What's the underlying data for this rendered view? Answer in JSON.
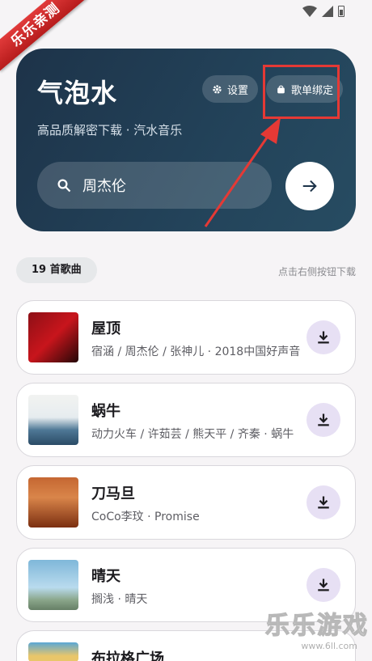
{
  "watermark": {
    "ribbon": "乐乐亲测",
    "brand": "乐乐游戏",
    "url": "www.6ll.com"
  },
  "header": {
    "title": "气泡水",
    "subtitle": "高品质解密下载 · 汽水音乐",
    "settings_label": "设置",
    "bind_label": "歌单绑定",
    "search_value": "周杰伦"
  },
  "summary": {
    "count_label": "19 首歌曲",
    "hint": "点击右侧按钮下载"
  },
  "songs": [
    {
      "title": "屋顶",
      "subtitle": "宿涵 / 周杰伦 / 张神儿 · 2018中国好声音"
    },
    {
      "title": "蜗牛",
      "subtitle": "动力火车 / 许茹芸 / 熊天平 / 齐秦 · 蜗牛"
    },
    {
      "title": "刀马旦",
      "subtitle": "CoCo李玟 · Promise"
    },
    {
      "title": "晴天",
      "subtitle": "搁浅 · 晴天"
    },
    {
      "title": "布拉格广场",
      "subtitle": ""
    }
  ],
  "colors": {
    "hero": "#1d3349",
    "accent_red": "#e53935",
    "download_bg": "#e7e0f4"
  },
  "icons": [
    "wifi-icon",
    "signal-icon",
    "battery-icon",
    "gear-icon",
    "bag-icon",
    "search-icon",
    "arrow-right-icon",
    "download-icon"
  ]
}
